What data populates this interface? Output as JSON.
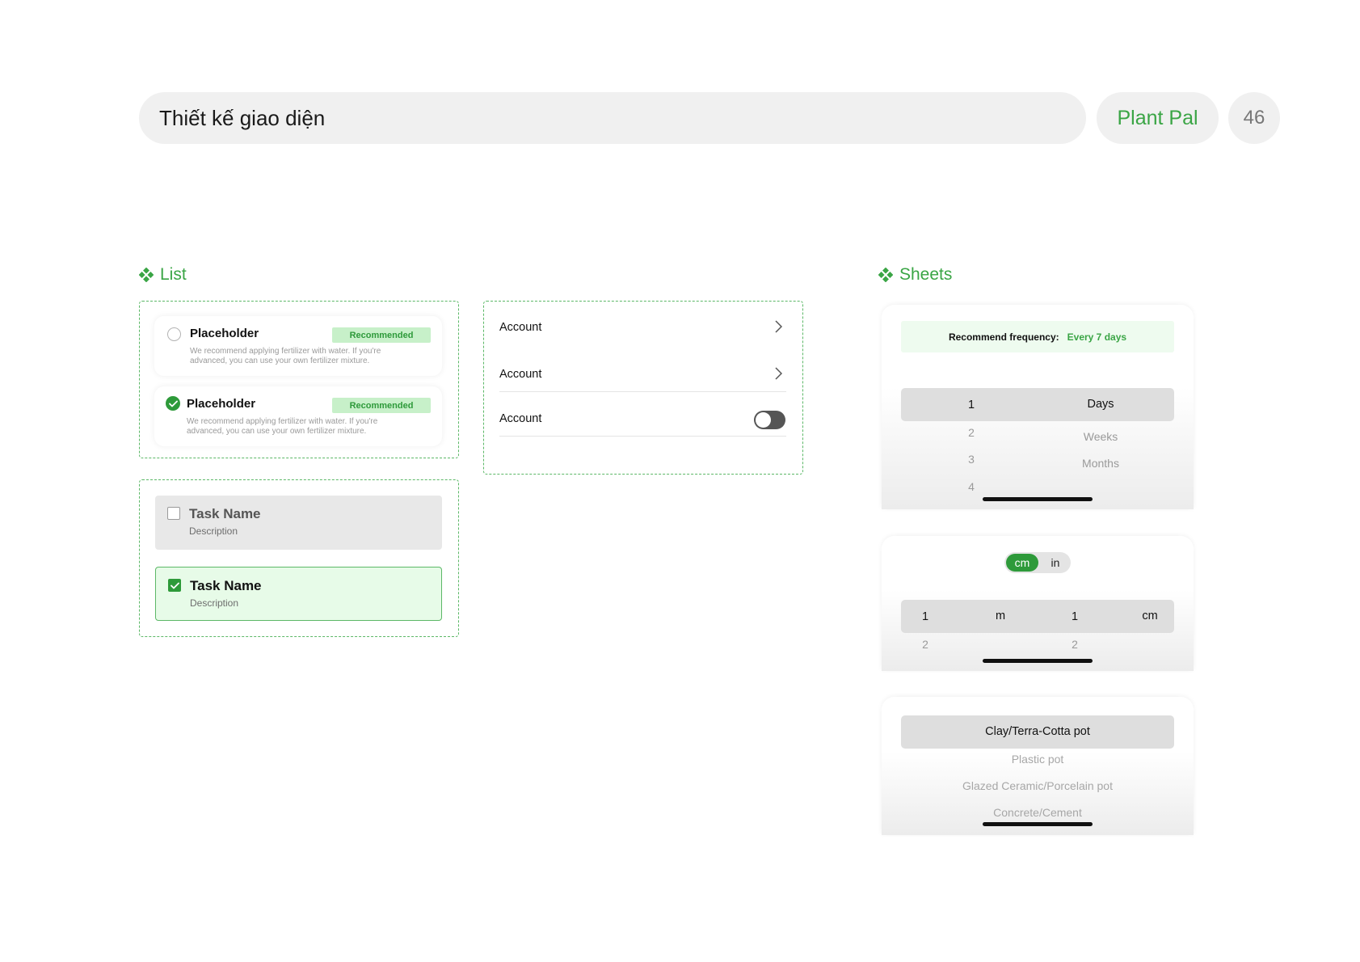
{
  "header": {
    "title": "Thiết kế giao diện",
    "brand": "Plant Pal",
    "page_number": "46"
  },
  "colors": {
    "accent": "#3aa545",
    "accent_dark": "#2e9a3a",
    "badge_bg": "#c7f0c9",
    "task_selected_bg": "#e7fbe8",
    "dashed_border": "#5cb867"
  },
  "list_section": {
    "title": "List",
    "options": [
      {
        "title": "Placeholder",
        "badge": "Recommended",
        "description": "We recommend applying fertilizer with water. If you're advanced, you can use your own fertilizer mixture.",
        "selected": false
      },
      {
        "title": "Placeholder",
        "badge": "Recommended",
        "description": "We recommend applying fertilizer with water. If you're advanced, you can use your own fertilizer mixture.",
        "selected": true
      }
    ],
    "tasks": [
      {
        "name": "Task Name",
        "description": "Description",
        "checked": false
      },
      {
        "name": "Task Name",
        "description": "Description",
        "checked": true
      }
    ],
    "settings": [
      {
        "label": "Account",
        "control": "chevron"
      },
      {
        "label": "Account",
        "control": "chevron"
      },
      {
        "label": "Account",
        "control": "toggle",
        "toggle_on": false
      }
    ]
  },
  "sheets_section": {
    "title": "Sheets",
    "frequency_sheet": {
      "label": "Recommend frequency:",
      "value": "Every 7 days",
      "number_options": [
        "1",
        "2",
        "3",
        "4"
      ],
      "unit_options": [
        "Days",
        "Weeks",
        "Months"
      ]
    },
    "measure_sheet": {
      "units": [
        "cm",
        "in"
      ],
      "selected_unit": "cm",
      "columns": [
        {
          "options": [
            "1",
            "2"
          ]
        },
        {
          "options": [
            "m"
          ]
        },
        {
          "options": [
            "1",
            "2"
          ]
        },
        {
          "options": [
            "cm"
          ]
        }
      ]
    },
    "pot_sheet": {
      "options": [
        "Clay/Terra-Cotta pot",
        "Plastic pot",
        "Glazed Ceramic/Porcelain pot",
        "Concrete/Cement"
      ]
    }
  }
}
